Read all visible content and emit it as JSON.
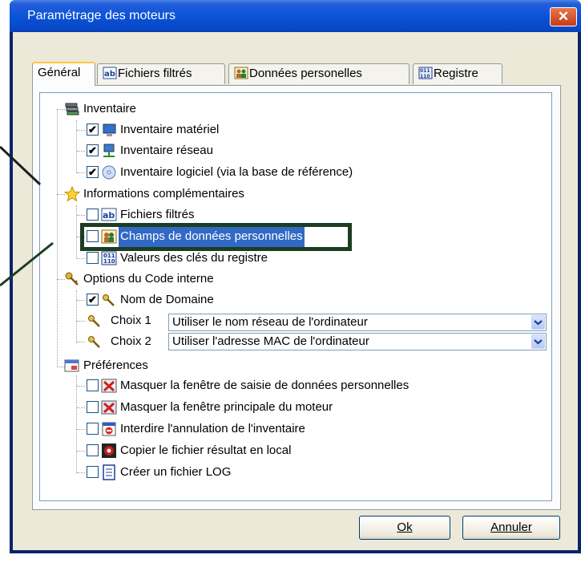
{
  "window": {
    "title": "Paramétrage des moteurs",
    "close_glyph": "✕"
  },
  "tabs": [
    {
      "label": "Général",
      "icon": null
    },
    {
      "label": "Fichiers filtrés",
      "icon": "ab-icon"
    },
    {
      "label": "Données personelles",
      "icon": "people-icon"
    },
    {
      "label": "Registre",
      "icon": "registry-icon"
    }
  ],
  "tree": {
    "inventaire": {
      "label": "Inventaire",
      "items": [
        {
          "label": "Inventaire matériel",
          "checked": true
        },
        {
          "label": "Inventaire réseau",
          "checked": true
        },
        {
          "label": "Inventaire logiciel (via la base de référence)",
          "checked": true
        }
      ]
    },
    "complementaires": {
      "label": "Informations complémentaires",
      "items": [
        {
          "label": "Fichiers filtrés",
          "checked": false
        },
        {
          "label": "Champs de données personnelles",
          "checked": false,
          "selected": true
        },
        {
          "label": "Valeurs des clés du registre",
          "checked": false
        }
      ]
    },
    "code_interne": {
      "label": "Options du Code interne",
      "domaine": {
        "label": "Nom de Domaine",
        "checked": true
      },
      "choix1": {
        "label": "Choix 1",
        "value": "Utiliser le nom réseau de l'ordinateur"
      },
      "choix2": {
        "label": "Choix 2",
        "value": "Utiliser l'adresse MAC de l'ordinateur"
      }
    },
    "preferences": {
      "label": "Préférences",
      "items": [
        {
          "label": "Masquer la fenêtre de saisie de données personnelles",
          "checked": false
        },
        {
          "label": "Masquer la fenêtre principale du moteur",
          "checked": false
        },
        {
          "label": "Interdire l'annulation de l'inventaire",
          "checked": false
        },
        {
          "label": "Copier le fichier résultat en local",
          "checked": false
        },
        {
          "label": "Créer un fichier LOG",
          "checked": false
        }
      ]
    }
  },
  "buttons": {
    "ok": "Ok",
    "cancel": "Annuler"
  },
  "colors": {
    "titlebar": "#0a53d8",
    "selection": "#316ac5",
    "highlight_box": "#1d3d22",
    "dialog_bg": "#ece9d8"
  },
  "check_glyph": "✔"
}
